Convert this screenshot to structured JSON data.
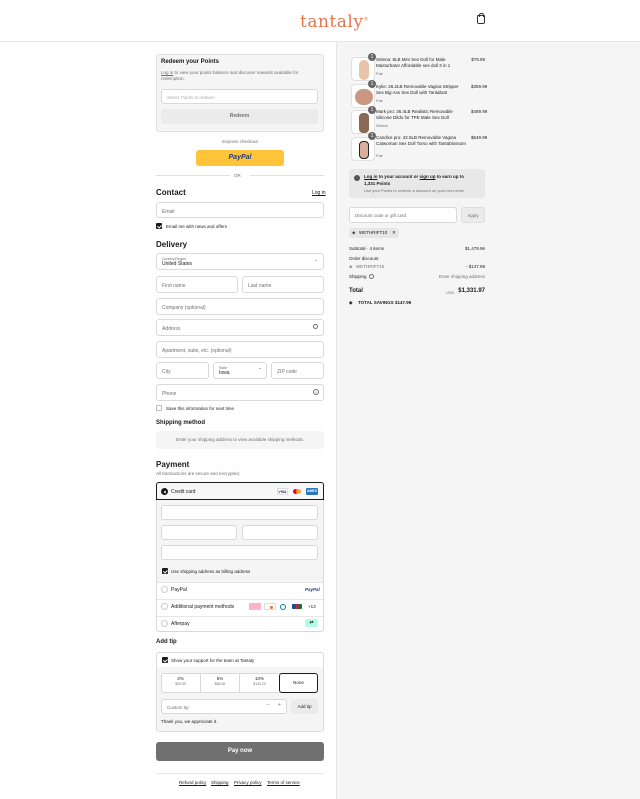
{
  "header": {
    "logo": "tantaly",
    "logo_mark": "®"
  },
  "points": {
    "title": "Redeem your Points",
    "login_link": "Log in",
    "desc": " to view your points balance and discover rewards available for redemption.",
    "placeholder": "Select Points to redeem",
    "button": "Redeem"
  },
  "express": {
    "label": "Express checkout",
    "paypal": "PayPal",
    "or": "OR"
  },
  "contact": {
    "title": "Contact",
    "login": "Log in",
    "email_placeholder": "Email",
    "news_label": "Email me with news and offers"
  },
  "delivery": {
    "title": "Delivery",
    "country_label": "Country/Region",
    "country_value": "United States",
    "first_name": "First name",
    "last_name": "Last name",
    "company": "Company (optional)",
    "address": "Address",
    "apartment": "Apartment, suite, etc. (optional)",
    "city": "City",
    "state_label": "State",
    "state_value": "Iowa",
    "zip": "ZIP code",
    "phone": "Phone",
    "save_label": "Save this information for next time"
  },
  "shipping": {
    "title": "Shipping method",
    "message": "Enter your shipping address to view available shipping methods."
  },
  "payment": {
    "title": "Payment",
    "subtitle": "All transactions are secure and encrypted.",
    "credit_card": "Credit card",
    "card_brands": [
      "VISA",
      "MC",
      "AMEX"
    ],
    "billing_label": "Use shipping address as billing address",
    "paypal": "PayPal",
    "paypal_logo": "PayPal",
    "additional": "Additional payment methods",
    "additional_more": "+13",
    "afterpay": "Afterpay"
  },
  "tip": {
    "title": "Add tip",
    "support_label": "Show your support for the team at Tantaly",
    "options": [
      {
        "pct": "2%",
        "amt": "$29.59"
      },
      {
        "pct": "5%",
        "amt": "$66.59"
      },
      {
        "pct": "10%",
        "amt": "$133.20"
      }
    ],
    "none": "None",
    "custom_placeholder": "Custom tip",
    "minus": "−",
    "plus": "+",
    "add_button": "Add tip",
    "thanks": "Thank you, we appreciate it."
  },
  "pay_button": "Pay now",
  "footer": {
    "links": [
      "Refund policy",
      "Shipping",
      "Privacy policy",
      "Terms of service"
    ]
  },
  "cart": {
    "items": [
      {
        "qty": "1",
        "name": "Selena: 8LB Mini Sex Doll for Male Masturbator Affordable sex doll 3 in 1",
        "variant": "Fair",
        "price": "$79.99"
      },
      {
        "qty": "1",
        "name": "Kylie: 26.2LB Removable Vagina Stripper Sex Big Ass Sex Doll with Tantabutt",
        "variant": "Fair",
        "price": "$359.99"
      },
      {
        "qty": "1",
        "name": "Mark pro: 36.4LB Realistic Removable Silicone Dildo for TPE Male Sex Doll",
        "variant": "Wheat",
        "price": "$489.99"
      },
      {
        "qty": "1",
        "name": "Candice pro: 42.5LB Removable Vagina Catwoman Sex Doll Torso with Tantablossom",
        "variant": "Fair",
        "price": "$549.99"
      }
    ],
    "login_prefix": "Log in",
    "login_mid": " to your account or ",
    "signup": "sign up",
    "login_suffix": " to earn up to",
    "points": "1,331 Points",
    "login_desc": "Use your Points to redeem a discount on your next order",
    "discount_placeholder": "Discount code or gift card",
    "apply": "Apply",
    "code": "WETHRIFT10",
    "subtotal_label": "Subtotal · 4 items",
    "subtotal_value": "$1,479.96",
    "order_discount": "Order discount",
    "discount_code": "WETHRIFT10",
    "discount_value": "- $147.99",
    "shipping_label": "Shipping",
    "shipping_value": "Enter shipping address",
    "total_label": "Total",
    "currency": "USD",
    "total_value": "$1,331.97",
    "savings_label": "TOTAL SAVINGS",
    "savings_value": "$147.99"
  },
  "colors": {
    "accent": "#e8744a",
    "paypal_yellow": "#ffc439",
    "paypal_blue": "#253b80"
  }
}
